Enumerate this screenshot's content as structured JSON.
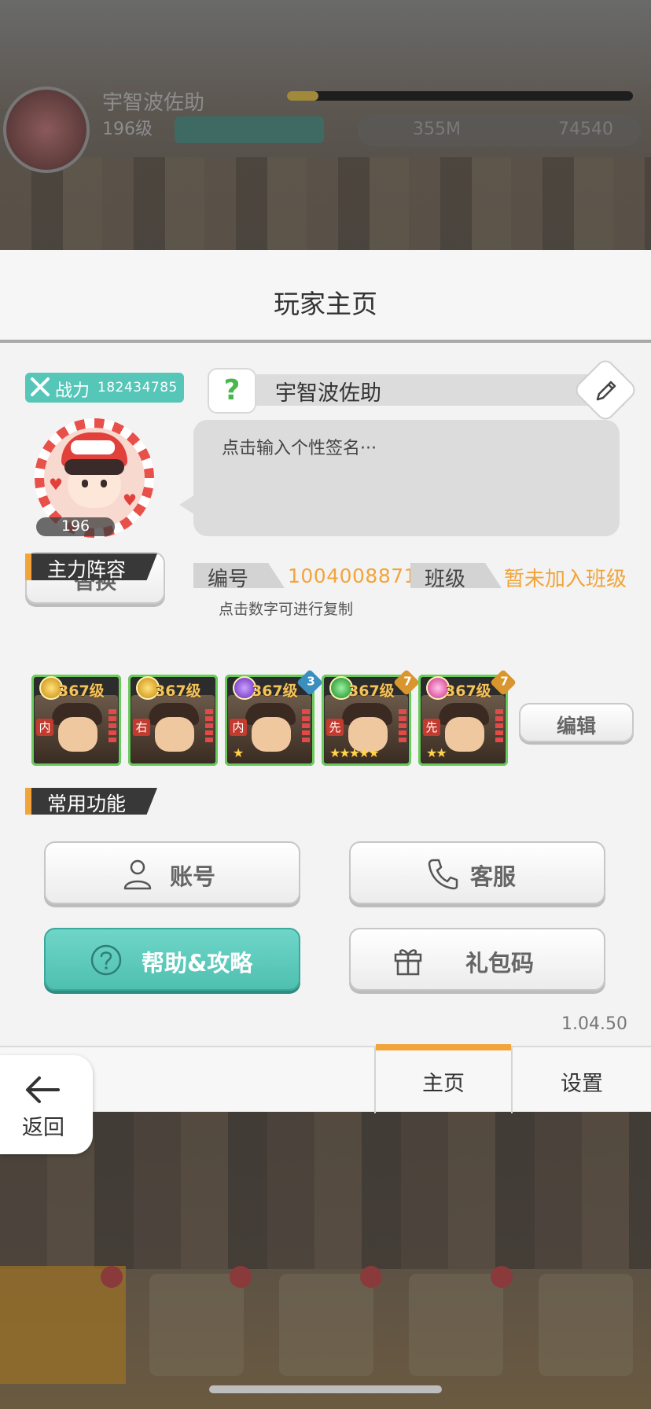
{
  "background": {
    "player_name": "宇智波佐助",
    "player_level": "196级",
    "gold": "355M",
    "gems": "74540"
  },
  "panel": {
    "title": "玩家主页",
    "power": {
      "label": "战力",
      "value": "182434785"
    },
    "avatar_level": "196",
    "replace_label": "替换",
    "name": "宇智波佐助",
    "question_mark": "?",
    "signature_placeholder": "点击输入个性签名···",
    "id_label": "编号",
    "id_value": "1004008871",
    "class_label": "班级",
    "class_value": "暂未加入班级",
    "copy_hint": "点击数字可进行复制",
    "team_section": "主力阵容",
    "team_edit_label": "编辑",
    "heroes": [
      {
        "level": "367级",
        "role": "内",
        "badge": "",
        "medal_color": "#e7b52d",
        "frame_color": "#6aca5a"
      },
      {
        "level": "367级",
        "role": "右",
        "badge": "",
        "medal_color": "#e7b52d",
        "frame_color": "#6aca5a"
      },
      {
        "level": "367级",
        "role": "内",
        "badge": "3",
        "medal_color": "#8a4ad0",
        "frame_color": "#6aca5a"
      },
      {
        "level": "367级",
        "role": "先",
        "badge": "7",
        "medal_color": "#3cb84a",
        "frame_color": "#6aca5a"
      },
      {
        "level": "367级",
        "role": "先",
        "badge": "7",
        "medal_color": "#e06ab0",
        "frame_color": "#6aca5a"
      }
    ],
    "functions_section": "常用功能",
    "functions": {
      "account": "账号",
      "service": "客服",
      "help": "帮助&攻略",
      "gift_code": "礼包码"
    },
    "version": "1.04.50"
  },
  "tabs": {
    "home": "主页",
    "settings": "设置"
  },
  "back_label": "返回",
  "colors": {
    "accent_teal": "#55c6b8",
    "accent_orange": "#f2a43a",
    "panel_bg": "#f3f3f3"
  }
}
